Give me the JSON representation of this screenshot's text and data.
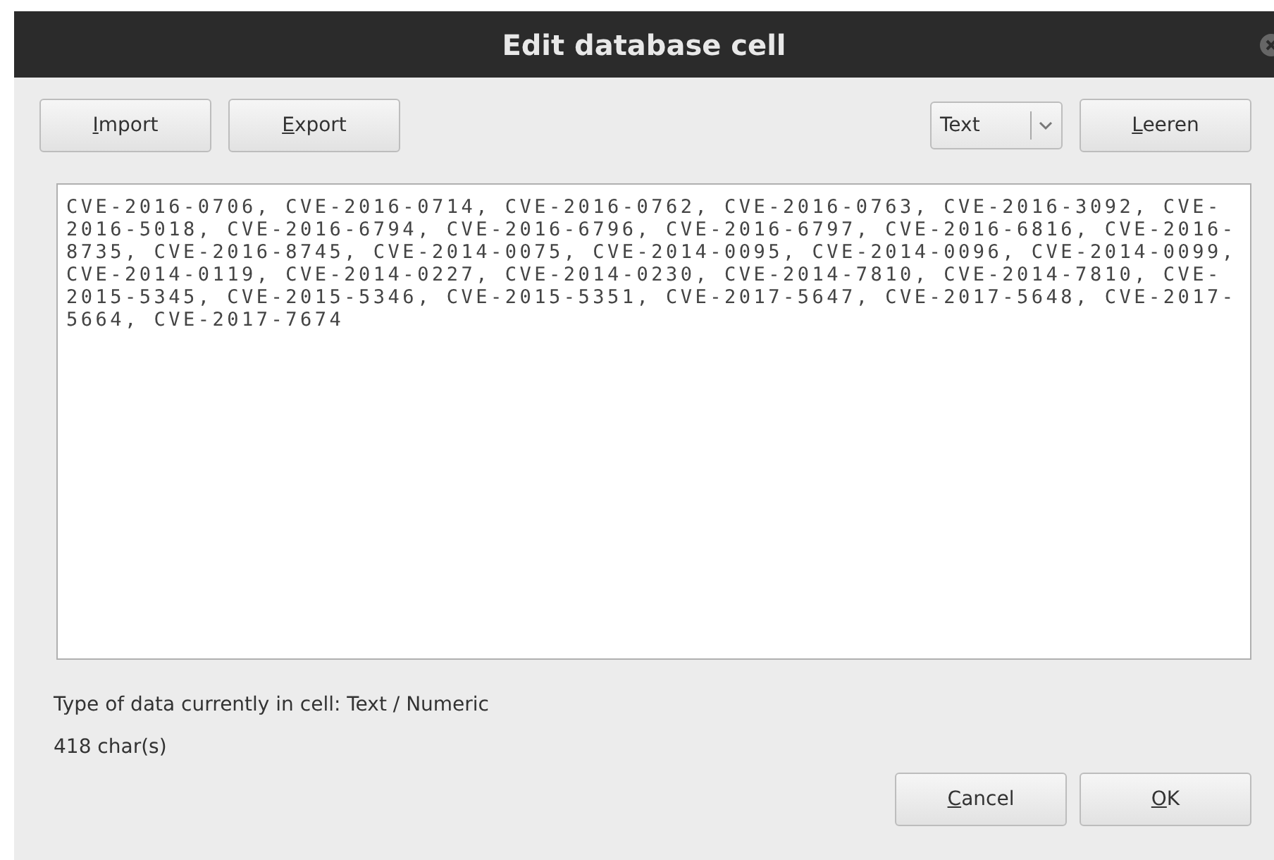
{
  "window": {
    "title": "Edit database cell"
  },
  "toolbar": {
    "buttons": [
      "Import",
      "Export"
    ],
    "mode_select": {
      "value": "Text"
    },
    "clear_button": "Leeren"
  },
  "editor": {
    "value": "CVE-2016-0706, CVE-2016-0714, CVE-2016-0762, CVE-2016-0763, CVE-2016-3092, CVE-2016-5018, CVE-2016-6794, CVE-2016-6796, CVE-2016-6797, CVE-2016-6816, CVE-2016-8735, CVE-2016-8745, CVE-2014-0075, CVE-2014-0095, CVE-2014-0096, CVE-2014-0099, CVE-2014-0119, CVE-2014-0227, CVE-2014-0230, CVE-2014-7810, CVE-2014-7810, CVE-2015-5345, CVE-2015-5346, CVE-2015-5351, CVE-2017-5647, CVE-2017-5648, CVE-2017-5664, CVE-2017-7674"
  },
  "status": {
    "type_info": "Type of data currently in cell: Text / Numeric",
    "char_count": "418 char(s)"
  },
  "buttons": [
    "Cancel",
    "OK"
  ]
}
